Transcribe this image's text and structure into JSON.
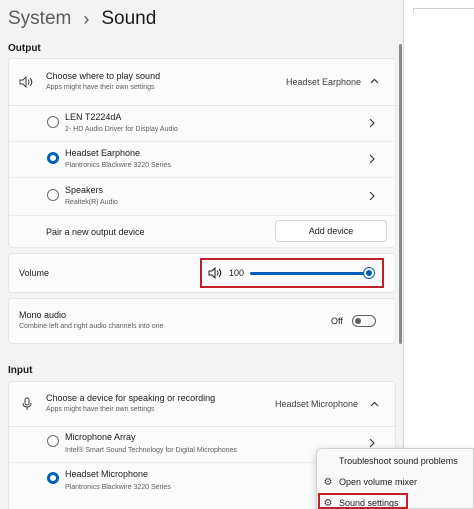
{
  "breadcrumb": {
    "root": "System",
    "separator": "›",
    "current": "Sound"
  },
  "output": {
    "section_label": "Output",
    "choose": {
      "title": "Choose where to play sound",
      "subtitle": "Apps might have their own settings",
      "value": "Headset Earphone",
      "icon": "speaker-icon",
      "chevron": "chevron-up-icon"
    },
    "devices": [
      {
        "name": "LEN T2224dA",
        "desc": "2- HD Audio Driver for Display Audio",
        "selected": false
      },
      {
        "name": "Headset Earphone",
        "desc": "Plantronics Blackwire 3220 Series",
        "selected": true
      },
      {
        "name": "Speakers",
        "desc": "Realtek(R) Audio",
        "selected": false
      }
    ],
    "pair": {
      "label": "Pair a new output device",
      "button": "Add device"
    }
  },
  "volume": {
    "label": "Volume",
    "value": "100",
    "level_percent": 100,
    "icon": "speaker-volume-icon"
  },
  "mono": {
    "title": "Mono audio",
    "subtitle": "Combine left and right audio channels into one",
    "state_label": "Off",
    "on": false
  },
  "input": {
    "section_label": "Input",
    "choose": {
      "title": "Choose a device for speaking or recording",
      "subtitle": "Apps might have their own settings",
      "value": "Headset Microphone",
      "icon": "microphone-icon",
      "chevron": "chevron-up-icon"
    },
    "devices": [
      {
        "name": "Microphone Array",
        "desc": "Intel® Smart Sound Technology for Digital Microphones",
        "selected": false
      },
      {
        "name": "Headset Microphone",
        "desc": "Plantronics Blackwire 3220 Series",
        "selected": true
      }
    ]
  },
  "context_menu": {
    "items": [
      {
        "label": "Troubleshoot sound problems",
        "icon": ""
      },
      {
        "label": "Open volume mixer",
        "icon": "gear-icon"
      },
      {
        "label": "Sound settings",
        "icon": "gear-icon"
      }
    ]
  },
  "colors": {
    "accent": "#005fb8",
    "highlight": "#c0202a",
    "background": "#f3f3f3",
    "card": "#fbfbfb"
  }
}
